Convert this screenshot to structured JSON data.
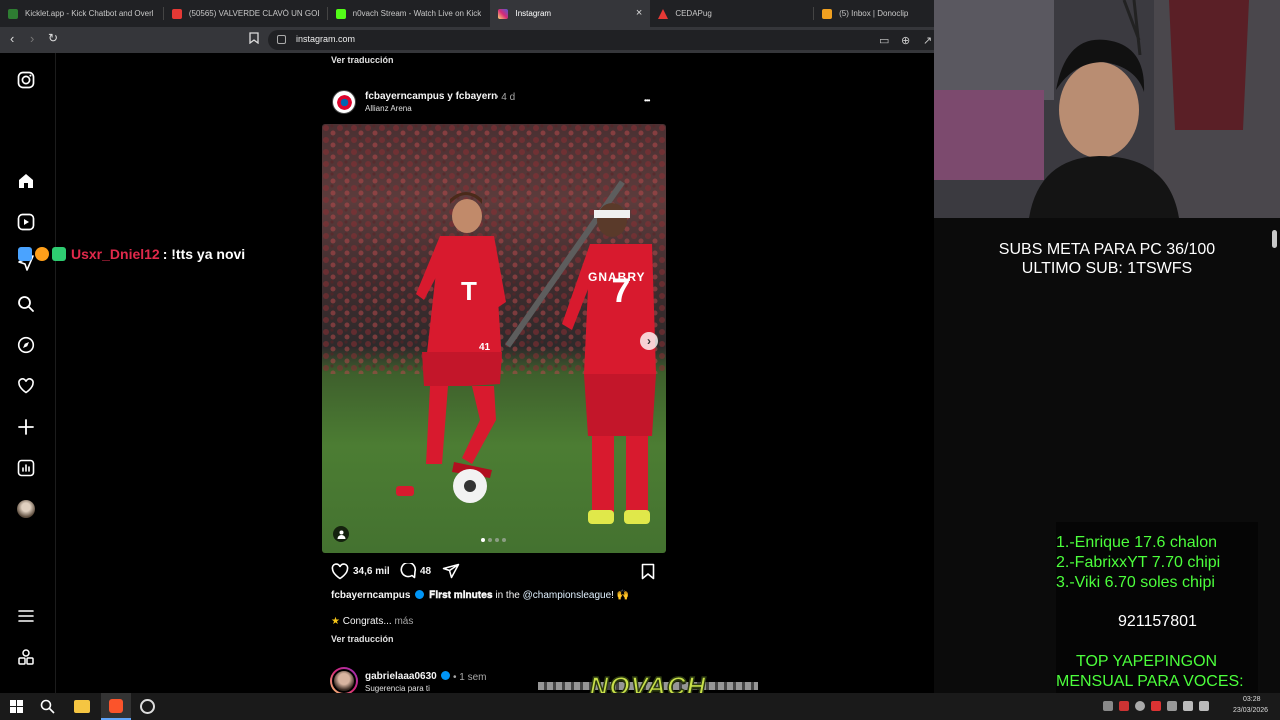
{
  "browser": {
    "tabs": [
      {
        "title": "Kicklet.app - Kick Chatbot and Overl",
        "color": "#2e7d32"
      },
      {
        "title": "(50565) VALVERDE CLAVÓ UN GOLA",
        "color": "#e53935"
      },
      {
        "title": "n0vach Stream - Watch Live on Kick",
        "color": "#53fc18"
      },
      {
        "title": "Instagram",
        "color": "#d62976",
        "active": true
      },
      {
        "title": "CEDAPug",
        "color": "#e53935"
      },
      {
        "title": "(5) Inbox | Donoclip",
        "color": "#f0a020"
      }
    ],
    "url": "instagram.com",
    "close_glyph": "×"
  },
  "chat": {
    "user": "Usxr_Dniel12",
    "message": ": !tts ya novi"
  },
  "post_prev": {
    "translate": "Ver traducción"
  },
  "post": {
    "authors": "fcbayerncampus y fcbayern",
    "age": "• 4 d",
    "location": "Allianz Arena",
    "more": "•••",
    "likes": "34,6 mil",
    "comments": "48",
    "caption_user": "fcbayerncampus",
    "caption_bold": "𝐅𝐢𝐫𝐬𝐭 𝐦𝐢𝐧𝐮𝐭𝐞𝐬",
    "caption_mid": "in the",
    "caption_mention": "@championsleague",
    "caption_end": "! 🙌",
    "comment_preview": "Congrats...",
    "comment_more": "más",
    "translate": "Ver traducción",
    "jersey_left": "41",
    "jersey_right_name": "GNABRY",
    "jersey_right_num": "7"
  },
  "next_post": {
    "user": "gabrielaaa0630",
    "age": "• 1 sem",
    "subtitle": "Sugerencia para ti"
  },
  "overlay": {
    "goal_line1": "SUBS META PARA PC 36/100",
    "goal_line2": "ULTIMO SUB: 1TSWFS",
    "donors": [
      "1.-Enrique 17.6 chalon",
      "2.-FabrixxYT 7.70 chipi",
      "3.-Viki 6.70 soles chipi"
    ],
    "phone": "921157801",
    "top_line1": "TOP YAPEPINGON",
    "top_line2": "MENSUAL PARA VOCES:",
    "banner": "NOVACH"
  },
  "taskbar": {
    "time": "03:28",
    "date": "23/03/2026"
  }
}
